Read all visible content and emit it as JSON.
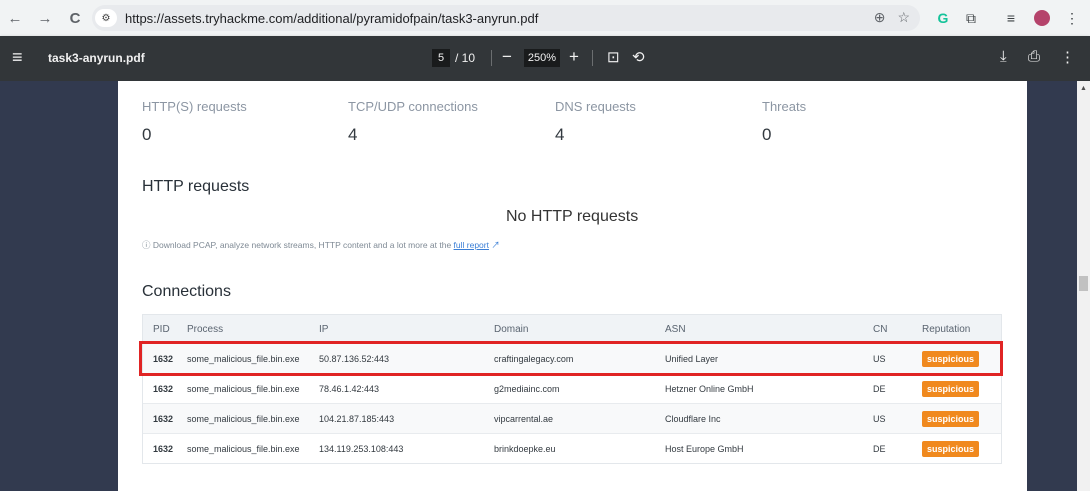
{
  "browser": {
    "url": "https://assets.tryhackme.com/additional/pyramidofpain/task3-anyrun.pdf"
  },
  "pdf_toolbar": {
    "title": "task3-anyrun.pdf",
    "page_current": "5",
    "page_total": "/ 10",
    "zoom": "250%"
  },
  "stats": [
    {
      "label": "HTTP(S) requests",
      "value": "0"
    },
    {
      "label": "TCP/UDP connections",
      "value": "4"
    },
    {
      "label": "DNS requests",
      "value": "4"
    },
    {
      "label": "Threats",
      "value": "0"
    }
  ],
  "http_section": {
    "title": "HTTP requests",
    "empty_text": "No HTTP requests",
    "info_text": "Download PCAP, analyze network streams, HTTP content and a lot more at the ",
    "info_link": "full report"
  },
  "connections": {
    "title": "Connections",
    "headers": [
      "PID",
      "Process",
      "IP",
      "Domain",
      "ASN",
      "CN",
      "Reputation"
    ],
    "rows": [
      {
        "pid": "1632",
        "process": "some_malicious_file.bin.exe",
        "ip": "50.87.136.52:443",
        "domain": "craftingalegacy.com",
        "asn": "Unified Layer",
        "cn": "US",
        "reputation": "suspicious"
      },
      {
        "pid": "1632",
        "process": "some_malicious_file.bin.exe",
        "ip": "78.46.1.42:443",
        "domain": "g2mediainc.com",
        "asn": "Hetzner Online GmbH",
        "cn": "DE",
        "reputation": "suspicious"
      },
      {
        "pid": "1632",
        "process": "some_malicious_file.bin.exe",
        "ip": "104.21.87.185:443",
        "domain": "vipcarrental.ae",
        "asn": "Cloudflare Inc",
        "cn": "US",
        "reputation": "suspicious"
      },
      {
        "pid": "1632",
        "process": "some_malicious_file.bin.exe",
        "ip": "134.119.253.108:443",
        "domain": "brinkdoepke.eu",
        "asn": "Host Europe GmbH",
        "cn": "DE",
        "reputation": "suspicious"
      }
    ]
  },
  "colors": {
    "suspicious_badge": "#f0891e",
    "highlight_box": "#e02424"
  }
}
